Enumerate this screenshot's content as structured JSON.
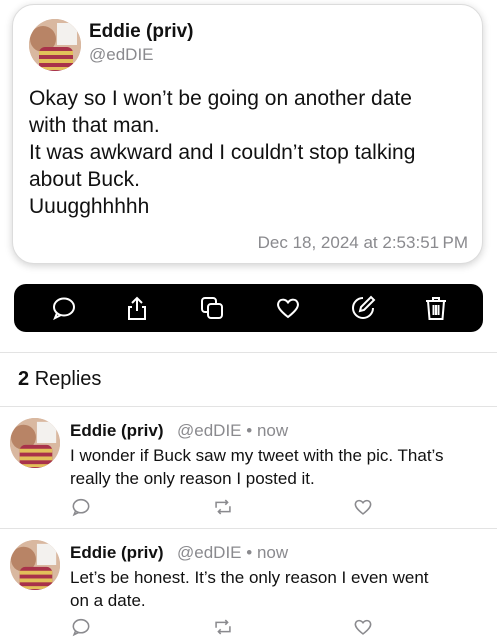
{
  "post": {
    "author_name": "Eddie (priv)",
    "author_handle": "@edDIE",
    "lines": [
      "Okay so I won’t be going on another date",
      "with that man.",
      "It was awkward and I couldn’t stop talking",
      "about Buck.",
      "Uuugghhhhh"
    ],
    "timestamp": "Dec 18, 2024 at 2:53:51 PM"
  },
  "toolbar": {
    "icons": [
      "comment-icon",
      "share-icon",
      "copy-icon",
      "heart-icon",
      "edit-icon",
      "trash-icon"
    ]
  },
  "replies_header": {
    "count": "2",
    "label": "Replies"
  },
  "replies": [
    {
      "author_name": "Eddie (priv)",
      "author_handle": "@edDIE",
      "separator": "•",
      "time": "now",
      "lines": [
        "I wonder if Buck saw my tweet with the pic. That’s",
        "really the only reason I posted it."
      ]
    },
    {
      "author_name": "Eddie (priv)",
      "author_handle": "@edDIE",
      "separator": "•",
      "time": "now",
      "lines": [
        "Let’s be honest. It’s the only reason I even went",
        "on a date."
      ]
    }
  ],
  "colors": {
    "toolbar_bg": "#000000",
    "muted_text": "#8a8a8e",
    "text": "#111111"
  }
}
